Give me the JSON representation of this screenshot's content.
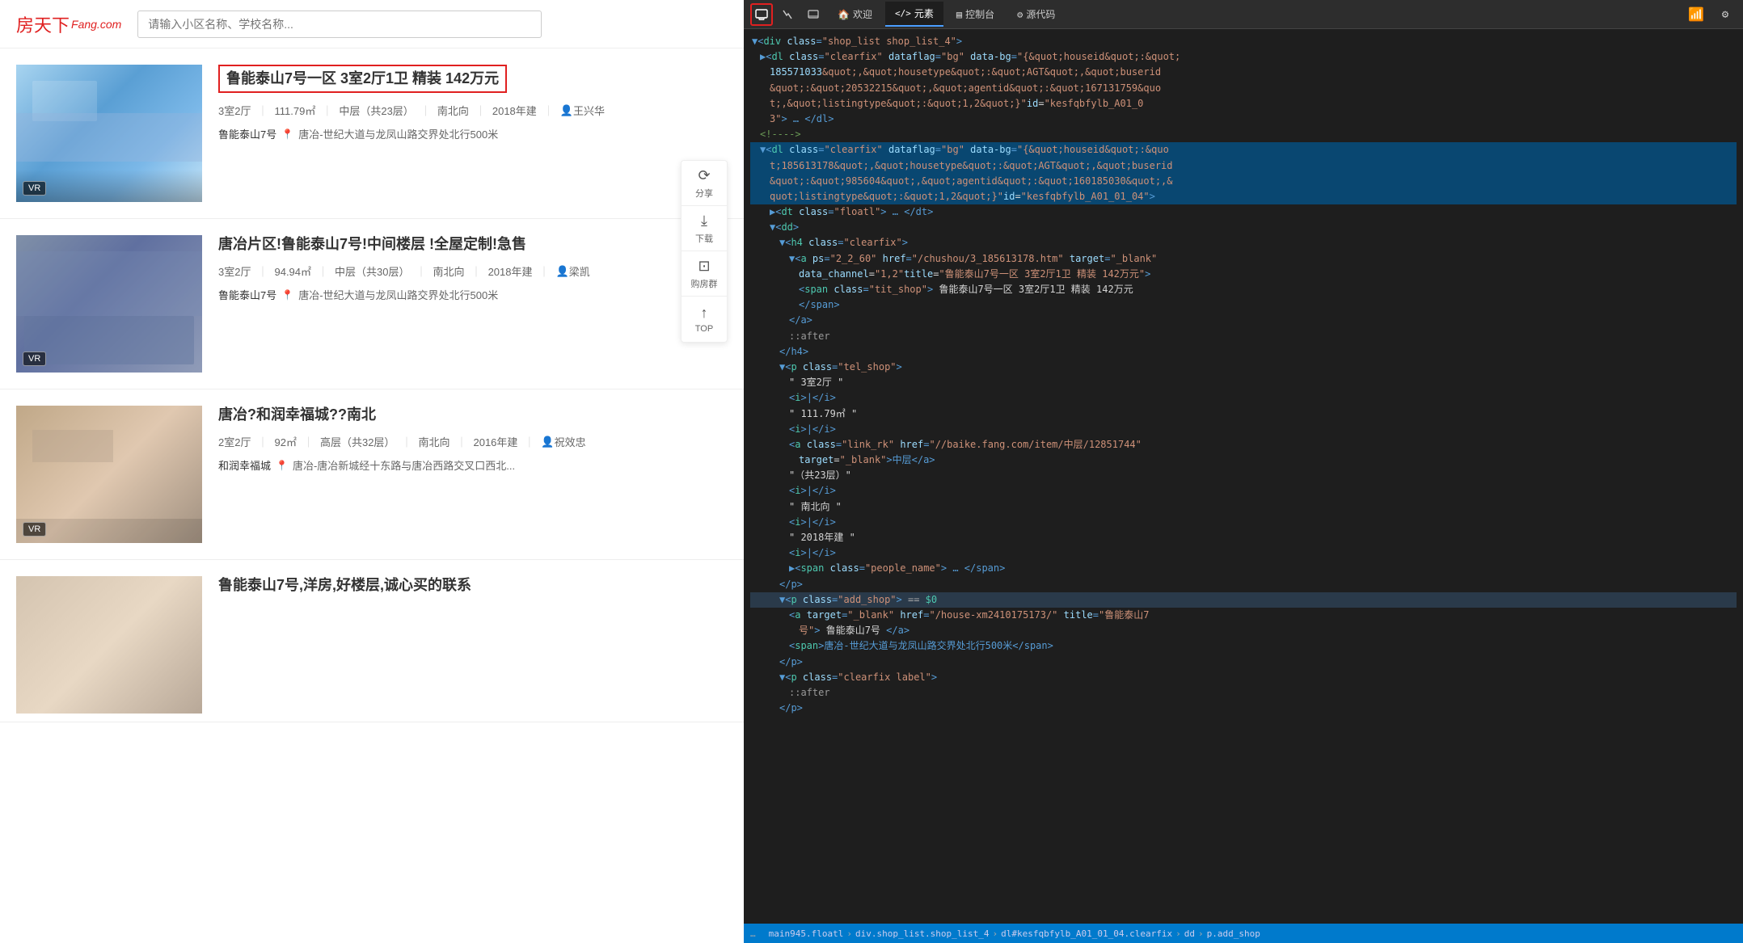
{
  "header": {
    "logo": "房天下",
    "logo_suffix": "Fang.com",
    "search_placeholder": "请输入小区名称、学校名称..."
  },
  "listings": [
    {
      "id": 1,
      "title": "鲁能泰山7号一区 3室2厅1卫 精装 142万元",
      "highlighted": true,
      "rooms": "3室2厅",
      "area": "111.79㎡",
      "floor": "中层（共23层）",
      "direction": "南北向",
      "year": "2018年建",
      "agent": "王兴华",
      "community": "鲁能泰山7号",
      "address": "唐冶-世纪大道与龙凤山路交界处北行500米",
      "has_vr": true,
      "img_class": "img-blue"
    },
    {
      "id": 2,
      "title": "唐冶片区!鲁能泰山7号!中间楼层 !全屋定制!急售",
      "highlighted": false,
      "rooms": "3室2厅",
      "area": "94.94㎡",
      "floor": "中层（共30层）",
      "direction": "南北向",
      "year": "2018年建",
      "agent": "梁凯",
      "community": "鲁能泰山7号",
      "address": "唐冶-世纪大道与龙凤山路交界处北行500米",
      "has_vr": true,
      "img_class": "img-living"
    },
    {
      "id": 3,
      "title": "唐冶?和润幸福城??南北",
      "highlighted": false,
      "rooms": "2室2厅",
      "area": "92㎡",
      "floor": "高层（共32层）",
      "direction": "南北向",
      "year": "2016年建",
      "agent": "祝效忠",
      "community": "和润幸福城",
      "address": "唐冶-唐冶新城经十东路与唐冶西路交叉口西北...",
      "has_vr": true,
      "img_class": "img-room"
    },
    {
      "id": 4,
      "title": "鲁能泰山7号,洋房,好楼层,诚心买的联系",
      "highlighted": false,
      "rooms": "",
      "area": "",
      "floor": "",
      "direction": "",
      "year": "",
      "agent": "",
      "community": "",
      "address": "",
      "has_vr": false,
      "img_class": "img-hallway"
    }
  ],
  "toolbar": {
    "share_label": "分享",
    "download_label": "下载",
    "group_label": "购房群",
    "top_label": "TOP"
  },
  "devtools": {
    "tabs": [
      {
        "label": "欢迎",
        "icon": "🏠",
        "active": false
      },
      {
        "label": "元素",
        "icon": "</>",
        "active": true
      },
      {
        "label": "控制台",
        "icon": "▤",
        "active": false
      },
      {
        "label": "源代码",
        "icon": "⚙",
        "active": false
      }
    ],
    "code_lines": [
      {
        "indent": 0,
        "content": "<div class=\"shop_list shop_list_4\">",
        "type": "tag"
      },
      {
        "indent": 1,
        "content": "▶<dl class=\"clearfix\" dataflag=\"bg\" data-bg=\"{&quot;houseid&quot;:&quot;185571033&quot;,&quot;housetype&quot;:&quot;AGT&quot;,&quot;buserid&quot;:&quot;20532215&quot;,&quot;agentid&quot;:&quot;167131759&quot;,&quot;listingtype&quot;:&quot;1,2&quot;}\" id=\"kesfqbfylb_A01_01_03\"> … </dl>",
        "type": "collapsed"
      },
      {
        "indent": 1,
        "content": "<!---->",
        "type": "comment"
      },
      {
        "indent": 1,
        "content": "▼<dl class=\"clearfix\" dataflag=\"bg\" data-bg=\"{&quot;houseid&quot;:&quot;185613178&quot;,&quot;housetype&quot;:&quot;AGT&quot;,&quot;buserid&quot;:&quot;985604&quot;,&quot;agentid&quot;:&quot;160185030&quot;,&quot;listingtype&quot;:&quot;1,2&quot;}\" id=\"kesfqbfylb_A01_01_04\">",
        "type": "expanded",
        "highlighted": true
      },
      {
        "indent": 2,
        "content": "▶<dt class=\"floatl\"> … </dt>",
        "type": "collapsed"
      },
      {
        "indent": 2,
        "content": "▼<dd>",
        "type": "tag"
      },
      {
        "indent": 3,
        "content": "▼<h4 class=\"clearfix\">",
        "type": "tag"
      },
      {
        "indent": 4,
        "content": "▼<a ps=\"2_2_60\" href=\"/chushou/3_185613178.htm\" target=\"_blank\" data_channel=\"1,2\" title=\"鲁能泰山7号一区 3室2厅1卫 精装 142万元\">",
        "type": "tag"
      },
      {
        "indent": 5,
        "content": "<span class=\"tit_shop\"> 鲁能泰山7号一区 3室2厅1卫 精装 142万元",
        "type": "tag"
      },
      {
        "indent": 5,
        "content": "</span>",
        "type": "tag"
      },
      {
        "indent": 4,
        "content": "</a>",
        "type": "tag"
      },
      {
        "indent": 4,
        "content": "::after",
        "type": "pseudo"
      },
      {
        "indent": 3,
        "content": "</h4>",
        "type": "tag"
      },
      {
        "indent": 3,
        "content": "▼<p class=\"tel_shop\">",
        "type": "tag"
      },
      {
        "indent": 4,
        "content": "\" 3室2厅 \"",
        "type": "text"
      },
      {
        "indent": 4,
        "content": "<i>|</i>",
        "type": "tag"
      },
      {
        "indent": 4,
        "content": "\" 111.79㎡ \"",
        "type": "text"
      },
      {
        "indent": 4,
        "content": "<i>|</i>",
        "type": "tag"
      },
      {
        "indent": 4,
        "content": "<a class=\"link_rk\" href=\"//baike.fang.com/item/中层/12851744\" target=\"_blank\">中层</a>",
        "type": "tag"
      },
      {
        "indent": 4,
        "content": "\" （共23层） \"",
        "type": "text"
      },
      {
        "indent": 4,
        "content": "<i>|</i>",
        "type": "tag"
      },
      {
        "indent": 4,
        "content": "\" 南北向 \"",
        "type": "text"
      },
      {
        "indent": 4,
        "content": "<i>|</i>",
        "type": "tag"
      },
      {
        "indent": 4,
        "content": "\" 2018年建 \"",
        "type": "text"
      },
      {
        "indent": 4,
        "content": "<i>|</i>",
        "type": "tag"
      },
      {
        "indent": 4,
        "content": "▶<span class=\"people_name\"> … </span>",
        "type": "collapsed"
      },
      {
        "indent": 3,
        "content": "</p>",
        "type": "tag"
      },
      {
        "indent": 3,
        "content": "▼<p class=\"add_shop\"> == $0",
        "type": "tag",
        "active": true
      },
      {
        "indent": 4,
        "content": "<a target=\"_blank\" href=\"/house-xm2410175173/\" title=\"鲁能泰山7号\"> 鲁能泰山7号 </a>",
        "type": "tag"
      },
      {
        "indent": 4,
        "content": "<span>唐冶-世纪大道与龙凤山路交界处北行500米</span>",
        "type": "tag"
      },
      {
        "indent": 3,
        "content": "</p>",
        "type": "tag"
      },
      {
        "indent": 3,
        "content": "▼<p class=\"clearfix label\">",
        "type": "tag"
      },
      {
        "indent": 4,
        "content": "::after",
        "type": "pseudo"
      },
      {
        "indent": 3,
        "content": "</p>",
        "type": "tag"
      }
    ],
    "bottom_breadcrumb": [
      "main945.floatl",
      "div.shop_list.shop_list_4",
      "dl#kesfqbfylb_A01_01_04.clearfix",
      "dd",
      "p.add_shop"
    ]
  }
}
